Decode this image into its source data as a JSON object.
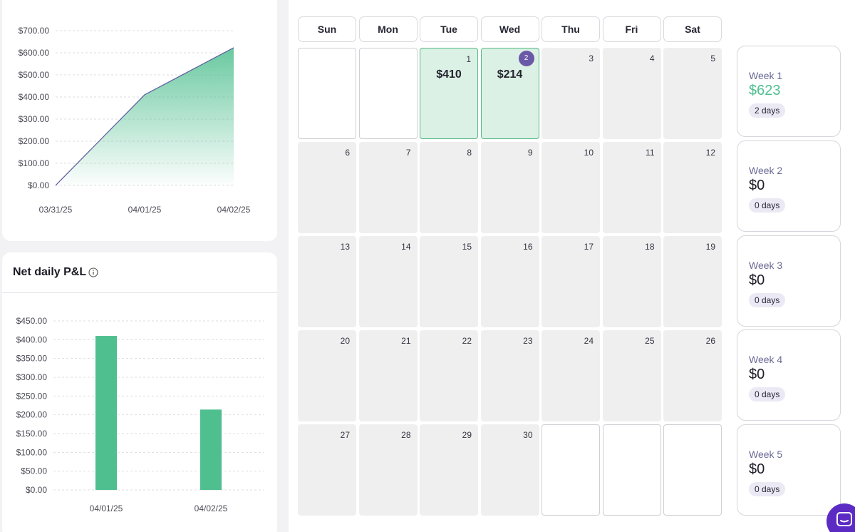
{
  "cumulative_chart": {
    "chart_data": {
      "type": "area",
      "x": [
        "03/31/25",
        "04/01/25",
        "04/02/25"
      ],
      "series": [
        {
          "values": [
            0,
            410,
            623
          ]
        }
      ],
      "ylim": [
        0,
        700
      ],
      "yticks": [
        "$700.00",
        "$600.00",
        "$500.00",
        "$400.00",
        "$300.00",
        "$200.00",
        "$100.00",
        "$0.00"
      ],
      "grid": true,
      "colors": {
        "line": "#5a5a9e",
        "fill": "#4fbf8f"
      }
    }
  },
  "daily_chart": {
    "title": "Net daily P&L",
    "info_icon": "info-circle-icon",
    "chart_data": {
      "type": "bar",
      "categories": [
        "04/01/25",
        "04/02/25"
      ],
      "values": [
        410,
        214
      ],
      "ylim": [
        0,
        450
      ],
      "yticks": [
        "$450.00",
        "$400.00",
        "$350.00",
        "$300.00",
        "$250.00",
        "$200.00",
        "$150.00",
        "$100.00",
        "$50.00",
        "$0.00"
      ],
      "grid": true,
      "colors": {
        "bar": "#4fbf8f"
      }
    }
  },
  "calendar": {
    "weekdays": [
      "Sun",
      "Mon",
      "Tue",
      "Wed",
      "Thu",
      "Fri",
      "Sat"
    ],
    "weeks": [
      [
        {
          "day": "",
          "type": "empty"
        },
        {
          "day": "",
          "type": "empty"
        },
        {
          "day": "1",
          "type": "trade",
          "pnl": "$410"
        },
        {
          "day": "2",
          "type": "trade",
          "pnl": "$214",
          "today": true
        },
        {
          "day": "3",
          "type": "grey"
        },
        {
          "day": "4",
          "type": "grey"
        },
        {
          "day": "5",
          "type": "grey"
        }
      ],
      [
        {
          "day": "6",
          "type": "grey"
        },
        {
          "day": "7",
          "type": "grey"
        },
        {
          "day": "8",
          "type": "grey"
        },
        {
          "day": "9",
          "type": "grey"
        },
        {
          "day": "10",
          "type": "grey"
        },
        {
          "day": "11",
          "type": "grey"
        },
        {
          "day": "12",
          "type": "grey"
        }
      ],
      [
        {
          "day": "13",
          "type": "grey"
        },
        {
          "day": "14",
          "type": "grey"
        },
        {
          "day": "15",
          "type": "grey"
        },
        {
          "day": "16",
          "type": "grey"
        },
        {
          "day": "17",
          "type": "grey"
        },
        {
          "day": "18",
          "type": "grey"
        },
        {
          "day": "19",
          "type": "grey"
        }
      ],
      [
        {
          "day": "20",
          "type": "grey"
        },
        {
          "day": "21",
          "type": "grey"
        },
        {
          "day": "22",
          "type": "grey"
        },
        {
          "day": "23",
          "type": "grey"
        },
        {
          "day": "24",
          "type": "grey"
        },
        {
          "day": "25",
          "type": "grey"
        },
        {
          "day": "26",
          "type": "grey"
        }
      ],
      [
        {
          "day": "27",
          "type": "grey"
        },
        {
          "day": "28",
          "type": "grey"
        },
        {
          "day": "29",
          "type": "grey"
        },
        {
          "day": "30",
          "type": "grey"
        },
        {
          "day": "",
          "type": "empty"
        },
        {
          "day": "",
          "type": "empty"
        },
        {
          "day": "",
          "type": "empty"
        }
      ]
    ],
    "week_summaries": [
      {
        "label": "Week 1",
        "amount": "$623",
        "days": "2 days",
        "positive": true
      },
      {
        "label": "Week 2",
        "amount": "$0",
        "days": "0 days",
        "positive": false
      },
      {
        "label": "Week 3",
        "amount": "$0",
        "days": "0 days",
        "positive": false
      },
      {
        "label": "Week 4",
        "amount": "$0",
        "days": "0 days",
        "positive": false
      },
      {
        "label": "Week 5",
        "amount": "$0",
        "days": "0 days",
        "positive": false
      }
    ]
  },
  "chat_launcher": {
    "icon": "chat-bubble-icon",
    "color": "#5c2bc4"
  }
}
